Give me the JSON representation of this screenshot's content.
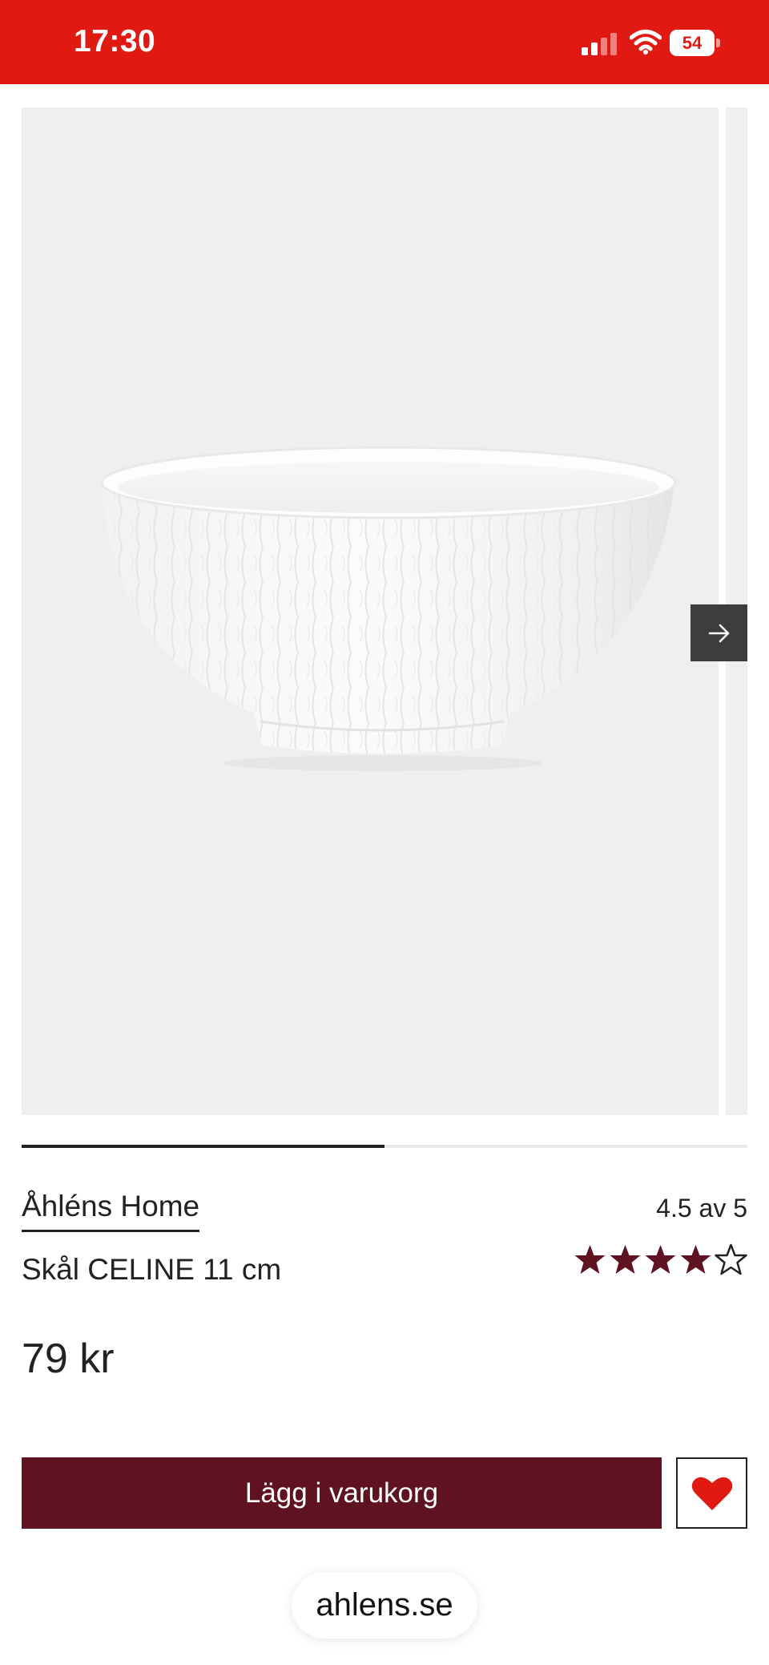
{
  "status_bar": {
    "time": "17:30",
    "battery_level": "54",
    "signal_icon": "cellular-signal-icon",
    "wifi_icon": "wifi-icon",
    "battery_icon": "battery-icon",
    "background_color": "#e01a13"
  },
  "gallery": {
    "image_subject": "white textured bowl",
    "next_icon": "arrow-right-icon",
    "progress": 0.5
  },
  "product": {
    "brand": "Åhléns Home",
    "name": "Skål CELINE 11 cm",
    "price": "79 kr",
    "rating_text": "4.5 av 5",
    "rating_value": 4.5,
    "rating_max": 5,
    "star_color": "#5f1220"
  },
  "actions": {
    "add_to_cart_label": "Lägg i varukorg",
    "add_to_cart_color": "#5f1220",
    "wishlist_icon": "heart-icon",
    "wishlist_color": "#e01a13"
  },
  "browser": {
    "url": "ahlens.se"
  }
}
